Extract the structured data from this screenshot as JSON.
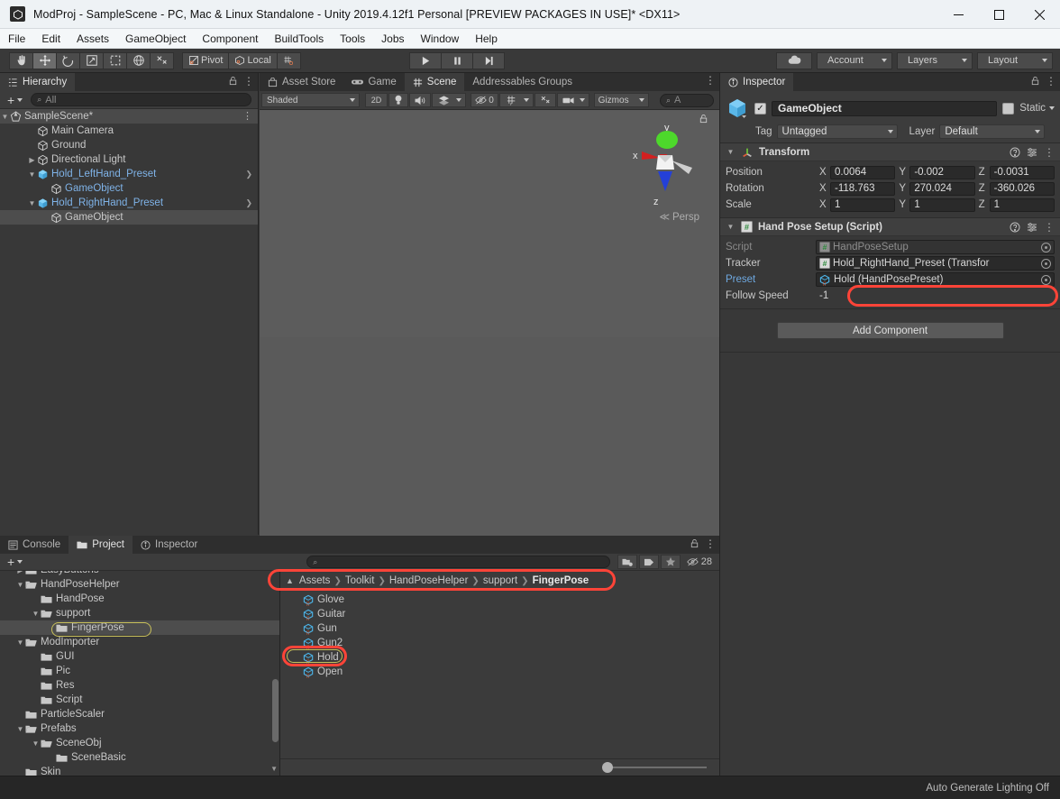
{
  "window": {
    "title": "ModProj - SampleScene - PC, Mac & Linux Standalone - Unity 2019.4.12f1 Personal [PREVIEW PACKAGES IN USE]* <DX11>",
    "minimize": "—",
    "maximize": "□",
    "close": "✕"
  },
  "menubar": [
    "File",
    "Edit",
    "Assets",
    "GameObject",
    "Component",
    "BuildTools",
    "Tools",
    "Jobs",
    "Window",
    "Help"
  ],
  "toolbar": {
    "tools": [
      "hand-tool",
      "move-tool",
      "rotate-tool",
      "scale-tool",
      "rect-tool",
      "transform-tool",
      "custom-tool"
    ],
    "pivot_label": "Pivot",
    "local_label": "Local",
    "snap_label": "grid-snap",
    "play_label": "▶",
    "pause_label": "‖",
    "step_label": "▶|",
    "cloud_label": "cloud",
    "account_label": "Account",
    "layers_label": "Layers",
    "layout_label": "Layout"
  },
  "hierarchy": {
    "tab": "Hierarchy",
    "create_label": "+",
    "search_placeholder": "All",
    "rows": [
      {
        "label": "SampleScene*",
        "depth": 0,
        "icon": "scene",
        "expanded": true,
        "selected_bg": true,
        "blue": false,
        "kebab": true
      },
      {
        "label": "Main Camera",
        "depth": 2,
        "icon": "gameobject",
        "expanded": null,
        "blue": false
      },
      {
        "label": "Ground",
        "depth": 2,
        "icon": "gameobject",
        "expanded": null,
        "blue": false
      },
      {
        "label": "Directional Light",
        "depth": 2,
        "icon": "gameobject",
        "expanded": false,
        "blue": false
      },
      {
        "label": "Hold_LeftHand_Preset",
        "depth": 2,
        "icon": "prefab",
        "expanded": true,
        "blue": true,
        "chevron": true
      },
      {
        "label": "GameObject",
        "depth": 3,
        "icon": "gameobject",
        "expanded": null,
        "blue": true
      },
      {
        "label": "Hold_RightHand_Preset",
        "depth": 2,
        "icon": "prefab",
        "expanded": true,
        "blue": true,
        "chevron": true
      },
      {
        "label": "GameObject",
        "depth": 3,
        "icon": "gameobject",
        "expanded": null,
        "blue": false,
        "selected": true
      }
    ]
  },
  "scene": {
    "tabs": [
      {
        "label": "Asset Store",
        "icon": "store-icon",
        "active": false
      },
      {
        "label": "Game",
        "icon": "game-icon",
        "active": false
      },
      {
        "label": "Scene",
        "icon": "scene-icon",
        "active": true
      },
      {
        "label": "Addressables Groups",
        "icon": "",
        "active": false
      }
    ],
    "toolbar": {
      "shading": "Shaded",
      "mode_2d": "2D",
      "light_icon": "lighting-icon",
      "audio_icon": "audio-icon",
      "fx_icon": "effects-icon",
      "hidden_count": "0",
      "grid_icon": "grid-visibility-icon",
      "tools_icon": "scene-tools-icon",
      "camera_icon": "scene-camera-icon",
      "gizmos": "Gizmos",
      "search_placeholder": "A"
    },
    "gizmo": {
      "x": "x",
      "y": "y",
      "z": "z",
      "projection": "Persp"
    }
  },
  "inspector": {
    "tab": "Inspector",
    "object_name": "GameObject",
    "enabled": true,
    "static_label": "Static",
    "tag_label": "Tag",
    "tag_value": "Untagged",
    "layer_label": "Layer",
    "layer_value": "Default",
    "transform": {
      "title": "Transform",
      "rows": [
        {
          "label": "Position",
          "x": "0.0064",
          "y": "-0.002",
          "z": "-0.0031"
        },
        {
          "label": "Rotation",
          "x": "-118.763",
          "y": "270.024",
          "z": "-360.026"
        },
        {
          "label": "Scale",
          "x": "1",
          "y": "1",
          "z": "1"
        }
      ]
    },
    "script_component": {
      "title": "Hand Pose Setup (Script)",
      "fields": [
        {
          "label": "Script",
          "value": "HandPoseSetup",
          "type": "object",
          "dim": true
        },
        {
          "label": "Tracker",
          "value": "Hold_RightHand_Preset (Transfor",
          "type": "object",
          "dim": false
        },
        {
          "label": "Preset",
          "value": "Hold (HandPosePreset)",
          "type": "object",
          "dim": false,
          "highlight": true
        },
        {
          "label": "Follow Speed",
          "value": "-1",
          "type": "plain",
          "dim": false
        }
      ]
    },
    "add_component": "Add Component"
  },
  "project": {
    "tabs": [
      {
        "label": "Console",
        "icon": "console-icon",
        "active": false
      },
      {
        "label": "Project",
        "icon": "folder-icon",
        "active": true
      },
      {
        "label": "Inspector",
        "icon": "info-icon",
        "active": false
      }
    ],
    "create_label": "+",
    "search_placeholder": "",
    "icon_buttons": [
      "packages-icon",
      "label-icon",
      "favorite-icon"
    ],
    "hidden_count": "28",
    "tree": [
      {
        "label": "EasyButtons",
        "depth": 1,
        "expanded": false,
        "clipped": true
      },
      {
        "label": "HandPoseHelper",
        "depth": 1,
        "expanded": true
      },
      {
        "label": "HandPose",
        "depth": 2,
        "expanded": null
      },
      {
        "label": "support",
        "depth": 2,
        "expanded": true
      },
      {
        "label": "FingerPose",
        "depth": 3,
        "expanded": null,
        "selected": true,
        "highlight": true
      },
      {
        "label": "ModImporter",
        "depth": 1,
        "expanded": true
      },
      {
        "label": "GUI",
        "depth": 2,
        "expanded": null
      },
      {
        "label": "Pic",
        "depth": 2,
        "expanded": null
      },
      {
        "label": "Res",
        "depth": 2,
        "expanded": null
      },
      {
        "label": "Script",
        "depth": 2,
        "expanded": null
      },
      {
        "label": "ParticleScaler",
        "depth": 1,
        "expanded": null
      },
      {
        "label": "Prefabs",
        "depth": 1,
        "expanded": true
      },
      {
        "label": "SceneObj",
        "depth": 2,
        "expanded": true
      },
      {
        "label": "SceneBasic",
        "depth": 3,
        "expanded": null
      },
      {
        "label": "Skin",
        "depth": 1,
        "expanded": null
      }
    ],
    "breadcrumb": [
      "Assets",
      "Toolkit",
      "HandPoseHelper",
      "support",
      "FingerPose"
    ],
    "assets": [
      {
        "label": "Glove",
        "selected": false
      },
      {
        "label": "Guitar",
        "selected": false
      },
      {
        "label": "Gun",
        "selected": false
      },
      {
        "label": "Gun2",
        "selected": false
      },
      {
        "label": "Hold",
        "selected": true,
        "highlight": true
      },
      {
        "label": "Open",
        "selected": false
      }
    ]
  },
  "statusbar": {
    "message": "Auto Generate Lighting Off"
  },
  "colors": {
    "accent_blue": "#6ea8e0",
    "highlight_red": "#ff4438",
    "highlight_yellow": "#c9c05a",
    "panel_bg": "#383838",
    "toolbar_bg": "#3c3c3c"
  }
}
